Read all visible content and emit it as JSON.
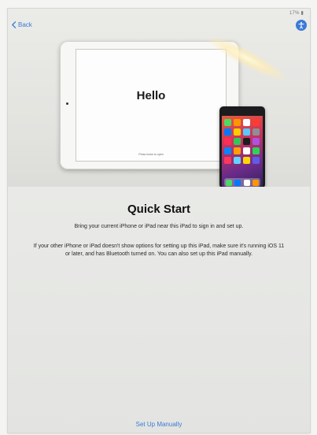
{
  "status": {
    "battery": "17% ▮"
  },
  "nav": {
    "back_label": "Back"
  },
  "hero": {
    "ipad_greeting": "Hello",
    "ipad_press_text": "Press home to open"
  },
  "main": {
    "title": "Quick Start",
    "subtitle": "Bring your current iPhone or iPad near this iPad to sign in and set up.",
    "body": "If your other iPhone or iPad doesn't show options for setting up this iPad, make sure it's running iOS 11 or later, and has Bluetooth turned on. You can also set up this iPad manually.",
    "manual_button": "Set Up Manually"
  },
  "icons": [
    "chevron-left-icon",
    "accessibility-icon"
  ],
  "colors": {
    "accent": "#3b7ad6"
  }
}
